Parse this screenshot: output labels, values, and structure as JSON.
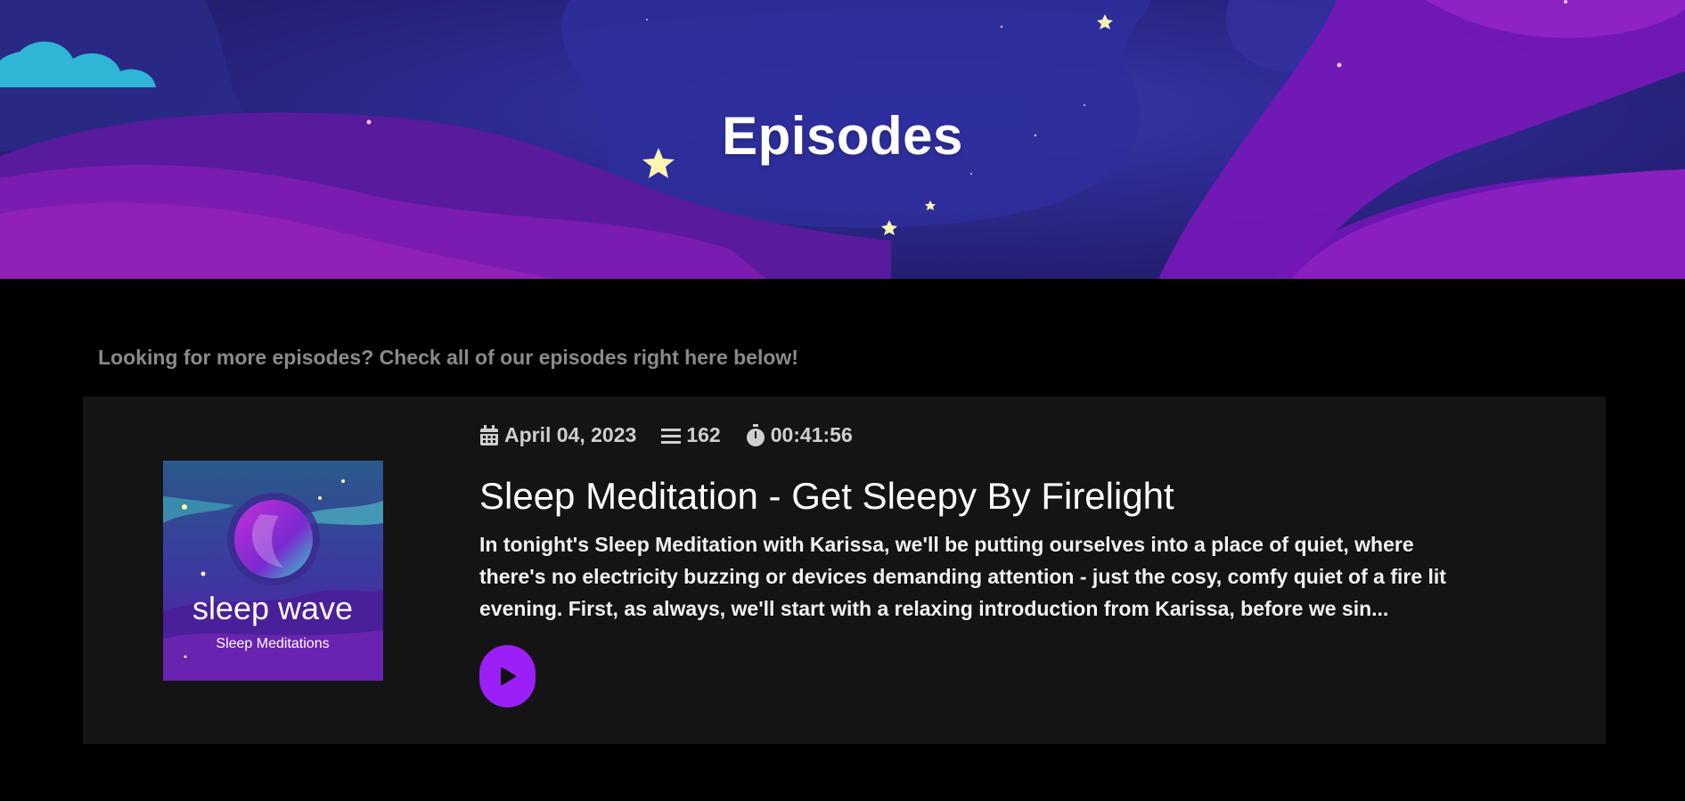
{
  "hero": {
    "title": "Episodes"
  },
  "intro_text": "Looking for more episodes? Check all of our episodes right here below!",
  "episode": {
    "date": "April 04, 2023",
    "number": "162",
    "duration": "00:41:56",
    "title": "Sleep Meditation - Get Sleepy By Firelight",
    "description": "In tonight's Sleep Meditation with Karissa, we'll be putting ourselves into a place of quiet, where there's no electricity buzzing or devices demanding attention - just the cosy, comfy quiet of a fire lit evening. First, as always, we'll start with a relaxing introduction from Karissa, before we sin...",
    "cover": {
      "brand": "sleep wave",
      "subtitle": "Sleep Meditations"
    },
    "icons": {
      "date": "calendar-icon",
      "number": "list-icon",
      "duration": "stopwatch-icon",
      "play": "play-icon"
    }
  },
  "colors": {
    "page_bg": "#000000",
    "card_bg": "#141414",
    "accent": "#9b1ff6",
    "muted_text": "#8a8a8a"
  }
}
